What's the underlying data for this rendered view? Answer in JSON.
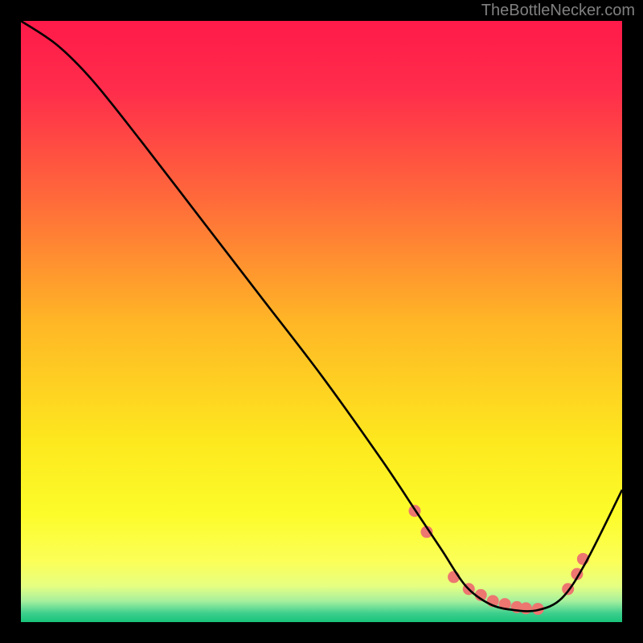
{
  "watermark": "TheBottleNecker.com",
  "chart_data": {
    "type": "line",
    "title": "",
    "xlabel": "",
    "ylabel": "",
    "xlim": [
      0,
      100
    ],
    "ylim": [
      0,
      100
    ],
    "series": [
      {
        "name": "curve",
        "x": [
          0,
          6,
          12,
          20,
          30,
          40,
          50,
          60,
          66,
          70,
          74,
          78,
          82,
          86,
          90,
          94,
          100
        ],
        "y": [
          100,
          96,
          90,
          80,
          67,
          54,
          41,
          27,
          18,
          12,
          6,
          3,
          2,
          2,
          4,
          10,
          22
        ]
      }
    ],
    "markers": {
      "name": "dots",
      "x": [
        65.5,
        67.5,
        72.0,
        74.5,
        76.5,
        78.5,
        80.5,
        82.5,
        84.0,
        86.0,
        91.0,
        92.5,
        93.5
      ],
      "y": [
        18.5,
        15.0,
        7.5,
        5.5,
        4.5,
        3.5,
        3.0,
        2.5,
        2.3,
        2.2,
        5.5,
        8.0,
        10.5
      ]
    },
    "background": {
      "main_stops": [
        {
          "offset": 0.0,
          "color": "#ff1a4a"
        },
        {
          "offset": 0.12,
          "color": "#ff2e4b"
        },
        {
          "offset": 0.3,
          "color": "#ff6b3a"
        },
        {
          "offset": 0.5,
          "color": "#ffb626"
        },
        {
          "offset": 0.7,
          "color": "#fde81e"
        },
        {
          "offset": 0.82,
          "color": "#fcfc2a"
        },
        {
          "offset": 0.9,
          "color": "#fbff58"
        },
        {
          "offset": 0.94,
          "color": "#e6ff82"
        },
        {
          "offset": 0.965,
          "color": "#a6f09e"
        },
        {
          "offset": 0.985,
          "color": "#3ecf8e"
        },
        {
          "offset": 1.0,
          "color": "#18c47a"
        }
      ]
    },
    "marker_color": "#ed7670",
    "curve_color": "#000000"
  }
}
